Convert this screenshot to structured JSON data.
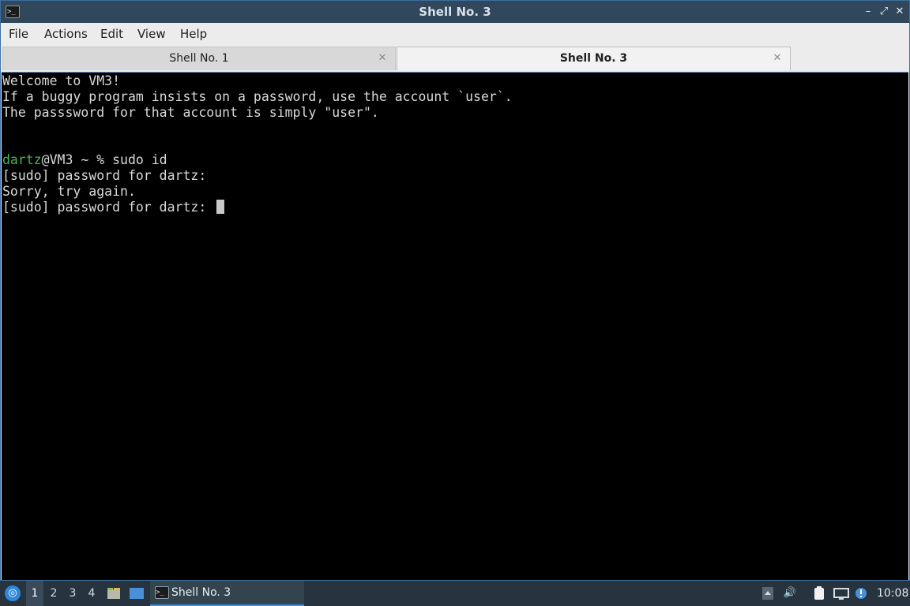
{
  "window": {
    "title": "Shell No. 3",
    "controls": {
      "minimize": "–",
      "restore": "⤢",
      "close": "✕"
    }
  },
  "menu": [
    "File",
    "Actions",
    "Edit",
    "View",
    "Help"
  ],
  "tabs": [
    {
      "label": "Shell No. 1",
      "active": false
    },
    {
      "label": "Shell No. 3",
      "active": true
    }
  ],
  "terminal": {
    "lines": [
      "Welcome to VM3!",
      "If a buggy program insists on a password, use the account `user`.",
      "The passsword for that account is simply \"user\".",
      ""
    ],
    "prompt_user": "dartz",
    "prompt_rest": "@VM3 ~ % sudo id",
    "output": [
      "[sudo] password for dartz:",
      "Sorry, try again.",
      "[sudo] password for dartz: "
    ]
  },
  "taskbar": {
    "desktops": [
      "1",
      "2",
      "3",
      "4"
    ],
    "active_desktop": "1",
    "task_label": "Shell No. 3",
    "clock": "10:08",
    "colors": {
      "accent": "#3d8fd6",
      "prompt_user": "#4fb34f"
    }
  }
}
